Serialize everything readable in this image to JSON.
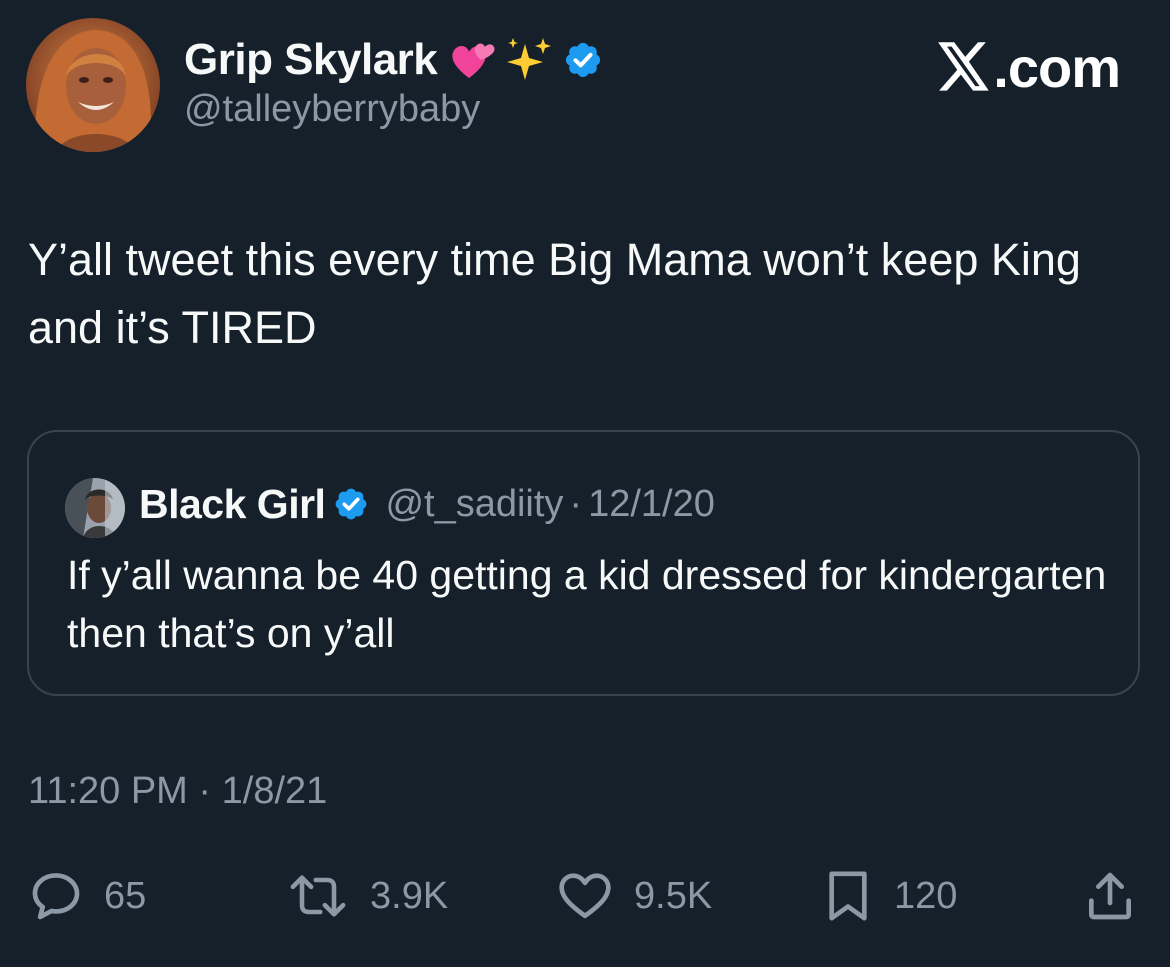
{
  "author": {
    "display_name": "Grip Skylark",
    "handle": "@talleyberrybaby",
    "emoji": [
      "two-hearts-icon",
      "sparkles-icon"
    ],
    "verified": true
  },
  "brand": {
    "icon": "x-logo-icon",
    "text": ".com"
  },
  "tweet": {
    "text": "Y’all tweet this every time Big Mama won’t keep King and it’s TIRED",
    "time": "11:20 PM",
    "separator": " · ",
    "date": "1/8/21"
  },
  "quoted_tweet": {
    "display_name": "Black Girl",
    "handle": "@t_sadiity",
    "separator": "·",
    "date": "12/1/20",
    "verified": true,
    "text": "If y’all wanna be 40 getting a kid dressed for kindergarten then that’s on y’all"
  },
  "actions": {
    "replies": "65",
    "retweets": "3.9K",
    "likes": "9.5K",
    "bookmarks": "120"
  },
  "colors": {
    "background": "#15202b",
    "primary_text": "#f7f9f9",
    "secondary_text": "#8b98a5",
    "border": "#38444d",
    "verified": "#1d9bf0"
  }
}
